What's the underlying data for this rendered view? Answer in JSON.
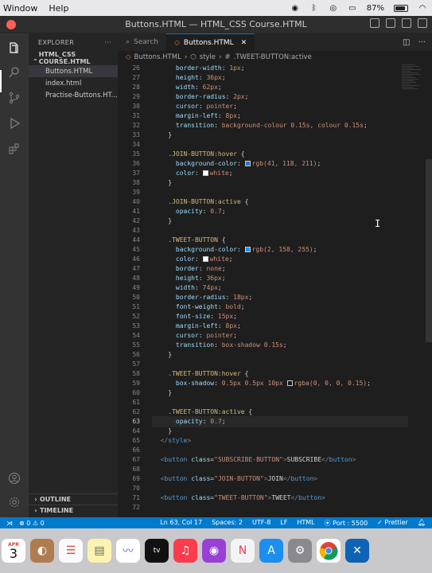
{
  "menubar": {
    "items": [
      "Window",
      "Help"
    ],
    "battery": "87%"
  },
  "window": {
    "title": "Buttons.HTML — HTML_CSS Course.HTML"
  },
  "sidebar": {
    "header": "EXPLORER",
    "more": "···",
    "folder": "HTML_CSS COURSE.HTML",
    "files": [
      "Buttons.HTML",
      "index.html",
      "Practise-Buttons.HT..."
    ],
    "outline": "OUTLINE",
    "timeline": "TIMELINE"
  },
  "tabs": [
    {
      "label": "Search",
      "icon": "search-icon"
    },
    {
      "label": "Buttons.HTML",
      "icon": "html-file-icon",
      "close": "✕"
    }
  ],
  "breadcrumb": {
    "file": "Buttons.HTML",
    "sep": "›",
    "element": "style",
    "selector": ".TWEET-BUTTON:active"
  },
  "editor": {
    "current_line": 63,
    "lines": [
      {
        "n": "26",
        "segs": [
          [
            "t-text",
            "      "
          ],
          [
            "t-prop",
            "border-width"
          ],
          [
            "t-punc",
            ": "
          ],
          [
            "t-val",
            "1px"
          ],
          [
            "t-punc",
            ";"
          ]
        ]
      },
      {
        "n": "27",
        "segs": [
          [
            "t-text",
            "      "
          ],
          [
            "t-prop",
            "height"
          ],
          [
            "t-punc",
            ": "
          ],
          [
            "t-val",
            "36px"
          ],
          [
            "t-punc",
            ";"
          ]
        ]
      },
      {
        "n": "28",
        "segs": [
          [
            "t-text",
            "      "
          ],
          [
            "t-prop",
            "width"
          ],
          [
            "t-punc",
            ": "
          ],
          [
            "t-val",
            "62px"
          ],
          [
            "t-punc",
            ";"
          ]
        ]
      },
      {
        "n": "29",
        "segs": [
          [
            "t-text",
            "      "
          ],
          [
            "t-prop",
            "border-radius"
          ],
          [
            "t-punc",
            ": "
          ],
          [
            "t-val",
            "2px"
          ],
          [
            "t-punc",
            ";"
          ]
        ]
      },
      {
        "n": "30",
        "segs": [
          [
            "t-text",
            "      "
          ],
          [
            "t-prop",
            "cursor"
          ],
          [
            "t-punc",
            ": "
          ],
          [
            "t-val",
            "pointer"
          ],
          [
            "t-punc",
            ";"
          ]
        ]
      },
      {
        "n": "31",
        "segs": [
          [
            "t-text",
            "      "
          ],
          [
            "t-prop",
            "margin-left"
          ],
          [
            "t-punc",
            ": "
          ],
          [
            "t-val",
            "8px"
          ],
          [
            "t-punc",
            ";"
          ]
        ]
      },
      {
        "n": "32",
        "segs": [
          [
            "t-text",
            "      "
          ],
          [
            "t-prop",
            "transition"
          ],
          [
            "t-punc",
            ": "
          ],
          [
            "t-val",
            "background-colour 0.15s, colour 0.15s"
          ],
          [
            "t-punc",
            ";"
          ]
        ]
      },
      {
        "n": "33",
        "segs": [
          [
            "t-text",
            "    "
          ],
          [
            "t-punc",
            "}"
          ]
        ]
      },
      {
        "n": "34",
        "segs": []
      },
      {
        "n": "35",
        "segs": [
          [
            "t-text",
            "    "
          ],
          [
            "t-sel",
            ".JOIN-BUTTON:hover"
          ],
          [
            "t-punc",
            " {"
          ]
        ]
      },
      {
        "n": "36",
        "segs": [
          [
            "t-text",
            "      "
          ],
          [
            "t-prop",
            "background-color"
          ],
          [
            "t-punc",
            ": "
          ],
          [
            "swatch",
            "#2971d3"
          ],
          [
            "t-val",
            "rgb(41, 118, 211)"
          ],
          [
            "t-punc",
            ";"
          ]
        ]
      },
      {
        "n": "37",
        "segs": [
          [
            "t-text",
            "      "
          ],
          [
            "t-prop",
            "color"
          ],
          [
            "t-punc",
            ": "
          ],
          [
            "swatch",
            "#ffffff"
          ],
          [
            "t-val",
            "white"
          ],
          [
            "t-punc",
            ";"
          ]
        ]
      },
      {
        "n": "38",
        "segs": [
          [
            "t-text",
            "    "
          ],
          [
            "t-punc",
            "}"
          ]
        ]
      },
      {
        "n": "39",
        "segs": []
      },
      {
        "n": "40",
        "segs": [
          [
            "t-text",
            "    "
          ],
          [
            "t-sel",
            ".JOIN-BUTTON:active"
          ],
          [
            "t-punc",
            " {"
          ]
        ]
      },
      {
        "n": "41",
        "segs": [
          [
            "t-text",
            "      "
          ],
          [
            "t-prop",
            "opacity"
          ],
          [
            "t-punc",
            ": "
          ],
          [
            "t-val",
            "0.7"
          ],
          [
            "t-punc",
            ";"
          ]
        ]
      },
      {
        "n": "42",
        "segs": [
          [
            "t-text",
            "    "
          ],
          [
            "t-punc",
            "}"
          ]
        ]
      },
      {
        "n": "43",
        "segs": []
      },
      {
        "n": "44",
        "segs": [
          [
            "t-text",
            "    "
          ],
          [
            "t-sel",
            ".TWEET-BUTTON"
          ],
          [
            "t-punc",
            " {"
          ]
        ]
      },
      {
        "n": "45",
        "segs": [
          [
            "t-text",
            "      "
          ],
          [
            "t-prop",
            "background-color"
          ],
          [
            "t-punc",
            ": "
          ],
          [
            "swatch",
            "#029eff"
          ],
          [
            "t-val",
            "rgb(2, 158, 255)"
          ],
          [
            "t-punc",
            ";"
          ]
        ]
      },
      {
        "n": "46",
        "segs": [
          [
            "t-text",
            "      "
          ],
          [
            "t-prop",
            "color"
          ],
          [
            "t-punc",
            ": "
          ],
          [
            "swatch",
            "#ffffff"
          ],
          [
            "t-val",
            "white"
          ],
          [
            "t-punc",
            ";"
          ]
        ]
      },
      {
        "n": "47",
        "segs": [
          [
            "t-text",
            "      "
          ],
          [
            "t-prop",
            "border"
          ],
          [
            "t-punc",
            ": "
          ],
          [
            "t-val",
            "none"
          ],
          [
            "t-punc",
            ";"
          ]
        ]
      },
      {
        "n": "48",
        "segs": [
          [
            "t-text",
            "      "
          ],
          [
            "t-prop",
            "height"
          ],
          [
            "t-punc",
            ": "
          ],
          [
            "t-val",
            "36px"
          ],
          [
            "t-punc",
            ";"
          ]
        ]
      },
      {
        "n": "49",
        "segs": [
          [
            "t-text",
            "      "
          ],
          [
            "t-prop",
            "width"
          ],
          [
            "t-punc",
            ": "
          ],
          [
            "t-val",
            "74px"
          ],
          [
            "t-punc",
            ";"
          ]
        ]
      },
      {
        "n": "50",
        "segs": [
          [
            "t-text",
            "      "
          ],
          [
            "t-prop",
            "border-radius"
          ],
          [
            "t-punc",
            ": "
          ],
          [
            "t-val",
            "18px"
          ],
          [
            "t-punc",
            ";"
          ]
        ]
      },
      {
        "n": "51",
        "segs": [
          [
            "t-text",
            "      "
          ],
          [
            "t-prop",
            "font-weight"
          ],
          [
            "t-punc",
            ": "
          ],
          [
            "t-val",
            "bold"
          ],
          [
            "t-punc",
            ";"
          ]
        ]
      },
      {
        "n": "52",
        "segs": [
          [
            "t-text",
            "      "
          ],
          [
            "t-prop",
            "font-size"
          ],
          [
            "t-punc",
            ": "
          ],
          [
            "t-val",
            "15px"
          ],
          [
            "t-punc",
            ";"
          ]
        ]
      },
      {
        "n": "53",
        "segs": [
          [
            "t-text",
            "      "
          ],
          [
            "t-prop",
            "margin-left"
          ],
          [
            "t-punc",
            ": "
          ],
          [
            "t-val",
            "8px"
          ],
          [
            "t-punc",
            ";"
          ]
        ]
      },
      {
        "n": "54",
        "segs": [
          [
            "t-text",
            "      "
          ],
          [
            "t-prop",
            "cursor"
          ],
          [
            "t-punc",
            ": "
          ],
          [
            "t-val",
            "pointer"
          ],
          [
            "t-punc",
            ";"
          ]
        ]
      },
      {
        "n": "55",
        "segs": [
          [
            "t-text",
            "      "
          ],
          [
            "t-prop",
            "transition"
          ],
          [
            "t-punc",
            ": "
          ],
          [
            "t-val",
            "box-shadow 0.15s"
          ],
          [
            "t-punc",
            ";"
          ]
        ]
      },
      {
        "n": "56",
        "segs": [
          [
            "t-text",
            "    "
          ],
          [
            "t-punc",
            "}"
          ]
        ]
      },
      {
        "n": "57",
        "segs": []
      },
      {
        "n": "58",
        "segs": [
          [
            "t-text",
            "    "
          ],
          [
            "t-sel",
            ".TWEET-BUTTON:hover"
          ],
          [
            "t-punc",
            " {"
          ]
        ]
      },
      {
        "n": "59",
        "segs": [
          [
            "t-text",
            "      "
          ],
          [
            "t-prop",
            "box-shadow"
          ],
          [
            "t-punc",
            ": "
          ],
          [
            "t-val",
            "0.5px 0.5px 10px "
          ],
          [
            "swatch",
            "rgba(0,0,0,0.15)"
          ],
          [
            "t-val",
            "rgba(0, 0, 0, 0.15)"
          ],
          [
            "t-punc",
            ";"
          ]
        ]
      },
      {
        "n": "60",
        "segs": [
          [
            "t-text",
            "    "
          ],
          [
            "t-punc",
            "}"
          ]
        ]
      },
      {
        "n": "61",
        "segs": []
      },
      {
        "n": "62",
        "segs": [
          [
            "t-text",
            "    "
          ],
          [
            "t-sel",
            ".TWEET-BUTTON:active"
          ],
          [
            "t-punc",
            " {"
          ]
        ]
      },
      {
        "n": "63",
        "segs": [
          [
            "t-text",
            "      "
          ],
          [
            "t-prop",
            "opacity"
          ],
          [
            "t-punc",
            ": "
          ],
          [
            "t-val",
            "0.7"
          ],
          [
            "t-punc",
            ";"
          ]
        ]
      },
      {
        "n": "64",
        "segs": [
          [
            "t-text",
            "    "
          ],
          [
            "t-punc",
            "}"
          ]
        ]
      },
      {
        "n": "65",
        "segs": [
          [
            "t-text",
            "  "
          ],
          [
            "t-tag",
            "</"
          ],
          [
            "t-tagname",
            "style"
          ],
          [
            "t-tag",
            ">"
          ]
        ]
      },
      {
        "n": "66",
        "segs": []
      },
      {
        "n": "67",
        "segs": [
          [
            "t-text",
            "  "
          ],
          [
            "t-tag",
            "<"
          ],
          [
            "t-tagname",
            "button"
          ],
          [
            "t-text",
            " "
          ],
          [
            "t-attr",
            "class"
          ],
          [
            "t-punc",
            "="
          ],
          [
            "t-str",
            "\"SUBSCRIBE-BUTTON\""
          ],
          [
            "t-tag",
            ">"
          ],
          [
            "t-text",
            "SUBSCRIBE"
          ],
          [
            "t-tag",
            "</"
          ],
          [
            "t-tagname",
            "button"
          ],
          [
            "t-tag",
            ">"
          ]
        ]
      },
      {
        "n": "68",
        "segs": []
      },
      {
        "n": "69",
        "segs": [
          [
            "t-text",
            "  "
          ],
          [
            "t-tag",
            "<"
          ],
          [
            "t-tagname",
            "button"
          ],
          [
            "t-text",
            " "
          ],
          [
            "t-attr",
            "class"
          ],
          [
            "t-punc",
            "="
          ],
          [
            "t-str",
            "\"JOIN-BUTTON\""
          ],
          [
            "t-tag",
            ">"
          ],
          [
            "t-text",
            "JOIN"
          ],
          [
            "t-tag",
            "</"
          ],
          [
            "t-tagname",
            "button"
          ],
          [
            "t-tag",
            ">"
          ]
        ]
      },
      {
        "n": "70",
        "segs": []
      },
      {
        "n": "71",
        "segs": [
          [
            "t-text",
            "  "
          ],
          [
            "t-tag",
            "<"
          ],
          [
            "t-tagname",
            "button"
          ],
          [
            "t-text",
            " "
          ],
          [
            "t-attr",
            "class"
          ],
          [
            "t-punc",
            "="
          ],
          [
            "t-str",
            "\"TWEET-BUTTON\""
          ],
          [
            "t-tag",
            ">"
          ],
          [
            "t-text",
            "TWEET"
          ],
          [
            "t-tag",
            "</"
          ],
          [
            "t-tagname",
            "button"
          ],
          [
            "t-tag",
            ">"
          ]
        ]
      },
      {
        "n": "72",
        "segs": []
      }
    ]
  },
  "statusbar": {
    "problems": "⊗ 0 ⚠ 0",
    "position": "Ln 63, Col 17",
    "spaces": "Spaces: 2",
    "encoding": "UTF-8",
    "eol": "LF",
    "language": "HTML",
    "port": "⦿ Port : 5500",
    "prettier": "✓ Prettier"
  },
  "dock": {
    "calendar_month": "APR",
    "calendar_day": "3",
    "apple_tv": "tv"
  },
  "colors": {
    "statusbar": "#007acc",
    "accent": "#0078d4"
  }
}
